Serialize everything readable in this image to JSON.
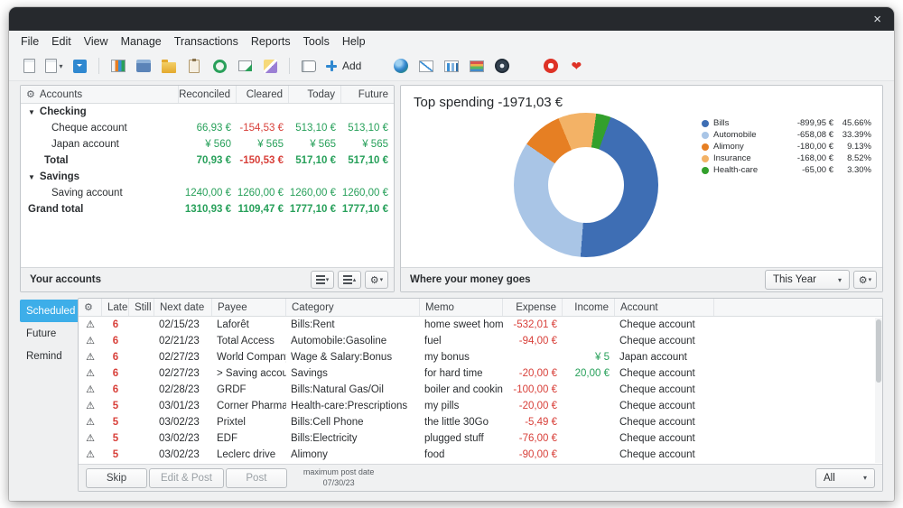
{
  "window": {
    "close_glyph": "×"
  },
  "icons": {
    "gear": "⚙",
    "chevron_down": "▾",
    "chevron_up": "▴",
    "warning": "⚠",
    "heart": "❤",
    "disclosure_down": "▼"
  },
  "menu": {
    "items": [
      "File",
      "Edit",
      "View",
      "Manage",
      "Transactions",
      "Reports",
      "Tools",
      "Help"
    ]
  },
  "toolbar": {
    "add_label": "Add"
  },
  "accounts_panel": {
    "footer_title": "Your accounts",
    "headers": [
      "Accounts",
      "Reconciled",
      "Cleared",
      "Today",
      "Future"
    ],
    "rows": [
      {
        "label": "Checking",
        "type": "group",
        "values": [
          "",
          "",
          "",
          ""
        ],
        "colors": [
          "",
          "",
          "",
          ""
        ]
      },
      {
        "label": "Cheque account",
        "type": "account",
        "values": [
          "66,93 €",
          "-154,53 €",
          "513,10 €",
          "513,10 €"
        ],
        "colors": [
          "pos",
          "neg",
          "pos",
          "pos"
        ]
      },
      {
        "label": "Japan account",
        "type": "account",
        "values": [
          "¥ 560",
          "¥ 565",
          "¥ 565",
          "¥ 565"
        ],
        "colors": [
          "pos",
          "pos",
          "pos",
          "pos"
        ]
      },
      {
        "label": "Total",
        "type": "total",
        "values": [
          "70,93 €",
          "-150,53 €",
          "517,10 €",
          "517,10 €"
        ],
        "colors": [
          "pos",
          "neg",
          "pos",
          "pos"
        ]
      },
      {
        "label": "Savings",
        "type": "group",
        "values": [
          "",
          "",
          "",
          ""
        ],
        "colors": [
          "",
          "",
          "",
          ""
        ]
      },
      {
        "label": "Saving account",
        "type": "account",
        "values": [
          "1240,00 €",
          "1260,00 €",
          "1260,00 €",
          "1260,00 €"
        ],
        "colors": [
          "pos",
          "pos",
          "pos",
          "pos"
        ]
      },
      {
        "label": "Grand total",
        "type": "grandtotal",
        "values": [
          "1310,93 €",
          "1109,47 €",
          "1777,10 €",
          "1777,10 €"
        ],
        "colors": [
          "pos",
          "pos",
          "pos",
          "pos"
        ]
      }
    ]
  },
  "report_panel": {
    "footer_title": "Where your money goes",
    "period_selector": "This Year"
  },
  "chart_data": {
    "type": "pie",
    "donut": true,
    "title": "Top spending -1971,03 €",
    "total": "-1971,03 €",
    "legend_position": "right",
    "slices": [
      {
        "label": "Bills",
        "amount": "-899,95 €",
        "percent": 45.66,
        "percent_label": "45.66%",
        "color": "#3e6eb4"
      },
      {
        "label": "Automobile",
        "amount": "-658,08 €",
        "percent": 33.39,
        "percent_label": "33.39%",
        "color": "#a9c5e6"
      },
      {
        "label": "Alimony",
        "amount": "-180,00 €",
        "percent": 9.13,
        "percent_label": "9.13%",
        "color": "#e67f23"
      },
      {
        "label": "Insurance",
        "amount": "-168,00 €",
        "percent": 8.52,
        "percent_label": "8.52%",
        "color": "#f3b266"
      },
      {
        "label": "Health-care",
        "amount": "-65,00 €",
        "percent": 3.3,
        "percent_label": "3.30%",
        "color": "#33a02c"
      }
    ]
  },
  "scheduled_panel": {
    "tabs": [
      {
        "label": "Scheduled",
        "selected": true
      },
      {
        "label": "Future",
        "selected": false
      },
      {
        "label": "Remind",
        "selected": false
      }
    ],
    "headers": {
      "late": "Late",
      "still": "Still",
      "next_date": "Next date",
      "payee": "Payee",
      "category": "Category",
      "memo": "Memo",
      "expense": "Expense",
      "income": "Income",
      "account": "Account"
    },
    "rows": [
      {
        "late": "6",
        "still": "",
        "next_date": "02/15/23",
        "payee": "Laforêt",
        "category": "Bills:Rent",
        "memo": "home sweet home",
        "expense": "-532,01 €",
        "income": "",
        "account": "Cheque account"
      },
      {
        "late": "6",
        "still": "",
        "next_date": "02/21/23",
        "payee": "Total Access",
        "category": "Automobile:Gasoline",
        "memo": "fuel",
        "expense": "-94,00 €",
        "income": "",
        "account": "Cheque account"
      },
      {
        "late": "6",
        "still": "",
        "next_date": "02/27/23",
        "payee": "World Company",
        "category": "Wage & Salary:Bonus",
        "memo": "my bonus",
        "expense": "",
        "income": "¥ 5",
        "account": "Japan account"
      },
      {
        "late": "6",
        "still": "",
        "next_date": "02/27/23",
        "payee": "> Saving account",
        "category": "Savings",
        "memo": "for hard time",
        "expense": "-20,00 €",
        "income": "20,00 €",
        "account": "Cheque account"
      },
      {
        "late": "6",
        "still": "",
        "next_date": "02/28/23",
        "payee": "GRDF",
        "category": "Bills:Natural Gas/Oil",
        "memo": "boiler and cooking",
        "expense": "-100,00 €",
        "income": "",
        "account": "Cheque account"
      },
      {
        "late": "5",
        "still": "",
        "next_date": "03/01/23",
        "payee": "Corner Pharma",
        "category": "Health-care:Prescriptions",
        "memo": "my pills",
        "expense": "-20,00 €",
        "income": "",
        "account": "Cheque account"
      },
      {
        "late": "5",
        "still": "",
        "next_date": "03/02/23",
        "payee": "Prixtel",
        "category": "Bills:Cell Phone",
        "memo": "the little 30Go",
        "expense": "-5,49 €",
        "income": "",
        "account": "Cheque account"
      },
      {
        "late": "5",
        "still": "",
        "next_date": "03/02/23",
        "payee": "EDF",
        "category": "Bills:Electricity",
        "memo": "plugged stuff",
        "expense": "-76,00 €",
        "income": "",
        "account": "Cheque account"
      },
      {
        "late": "5",
        "still": "",
        "next_date": "03/02/23",
        "payee": "Leclerc drive",
        "category": "Alimony",
        "memo": "food",
        "expense": "-90,00 €",
        "income": "",
        "account": "Cheque account"
      }
    ],
    "footer": {
      "skip_label": "Skip",
      "edit_post_label": "Edit & Post",
      "post_label": "Post",
      "max_post_date_label": "maximum post date",
      "max_post_date": "07/30/23",
      "filter_label": "All"
    }
  },
  "colors": {
    "accent": "#3daee9",
    "positive": "#27a05a",
    "negative": "#d8403a"
  }
}
